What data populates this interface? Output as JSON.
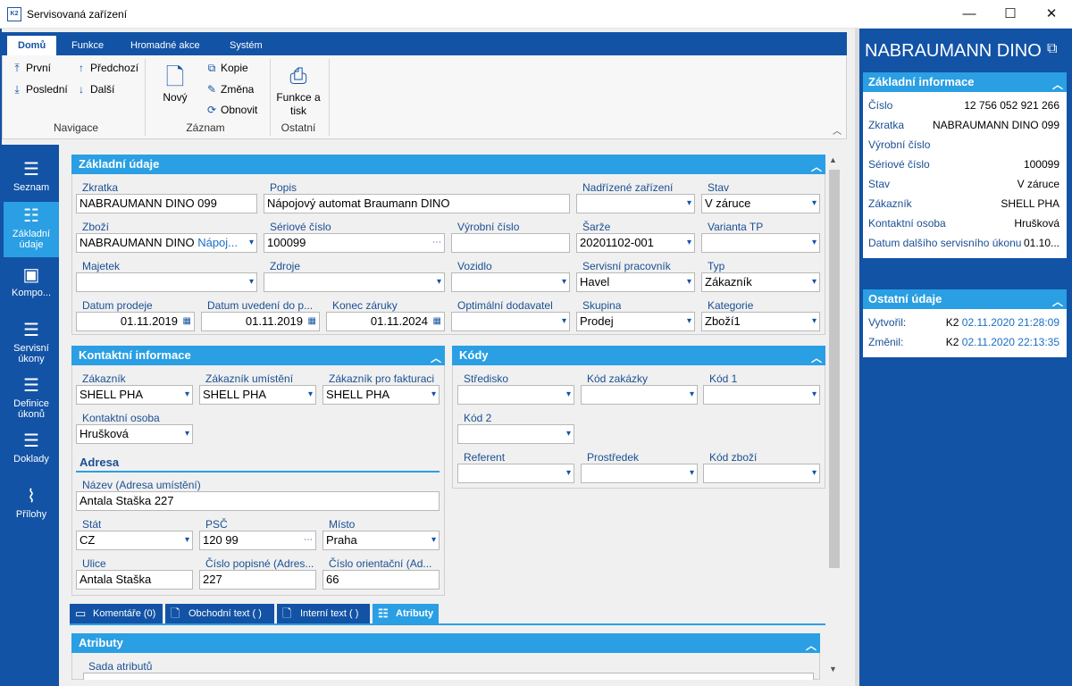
{
  "window": {
    "title": "Servisovaná zařízení",
    "minimize": "—",
    "maximize": "☐",
    "close": "✕"
  },
  "ribbon": {
    "tabs": [
      "Domů",
      "Funkce",
      "Hromadné akce",
      "Systém"
    ],
    "nav": {
      "first": "První",
      "prev": "Předchozí",
      "last": "Poslední",
      "next": "Další",
      "group": "Navigace"
    },
    "record": {
      "new": "Nový",
      "copy": "Kopie",
      "change": "Změna",
      "refresh": "Obnovit",
      "group": "Záznam"
    },
    "other": {
      "print": "Funkce a tisk",
      "group": "Ostatní"
    }
  },
  "leftnav": [
    "Seznam",
    "Základní údaje",
    "Kompo...",
    "Servisní úkony",
    "Definice úkonů",
    "Doklady",
    "Přílohy"
  ],
  "basic": {
    "title": "Základní údaje",
    "zkratka_l": "Zkratka",
    "zkratka": "NABRAUMANN DINO 099",
    "popis_l": "Popis",
    "popis": "Nápojový automat Braumann DINO",
    "nadrizene_l": "Nadřízené zařízení",
    "nadrizene": "",
    "stav_l": "Stav",
    "stav": "V záruce",
    "zbozi_l": "Zboží",
    "zbozi": "NABRAUMANN DINO",
    "zbozi2": "Nápoj...",
    "seriove_l": "Sériové číslo",
    "seriove": "100099",
    "vyrobni_l": "Výrobní číslo",
    "vyrobni": "",
    "sarze_l": "Šarže",
    "sarze": "20201102-001",
    "varianta_l": "Varianta TP",
    "varianta": "",
    "majetek_l": "Majetek",
    "majetek": "",
    "zdroje_l": "Zdroje",
    "zdroje": "",
    "vozidlo_l": "Vozidlo",
    "vozidlo": "",
    "pracovnik_l": "Servisní pracovník",
    "pracovnik": "Havel",
    "typ_l": "Typ",
    "typ": "Zákazník",
    "prodej_l": "Datum prodeje",
    "prodej": "01.11.2019",
    "uvedeni_l": "Datum uvedení do p...",
    "uvedeni": "01.11.2019",
    "zaruka_l": "Konec záruky",
    "zaruka": "01.11.2024",
    "dodavatel_l": "Optimální dodavatel",
    "dodavatel": "",
    "skupina_l": "Skupina",
    "skupina": "Prodej",
    "kategorie_l": "Kategorie",
    "kategorie": "Zboží1"
  },
  "contact": {
    "title": "Kontaktní informace",
    "zak_l": "Zákazník",
    "zak": "SHELL PHA",
    "zakum_l": "Zákazník umístění",
    "zakum": "SHELL PHA",
    "zakfak_l": "Zákazník pro fakturaci",
    "zakfak": "SHELL PHA",
    "osoba_l": "Kontaktní osoba",
    "osoba": "Hrušková",
    "adresa": "Adresa",
    "nazev_l": "Název (Adresa umístění)",
    "nazev": "Antala Staška 227",
    "stat_l": "Stát",
    "stat": "CZ",
    "psc_l": "PSČ",
    "psc": "120 99",
    "misto_l": "Místo",
    "misto": "Praha",
    "ulice_l": "Ulice",
    "ulice": "Antala Staška",
    "popisne_l": "Číslo popisné (Adres...",
    "popisne": "227",
    "orient_l": "Číslo orientační (Ad...",
    "orient": "66"
  },
  "codes": {
    "title": "Kódy",
    "stredisko_l": "Středisko",
    "zakazka_l": "Kód zakázky",
    "kod1_l": "Kód 1",
    "kod2_l": "Kód 2",
    "referent_l": "Referent",
    "prostredek_l": "Prostředek",
    "kodzbozi_l": "Kód zboží"
  },
  "btabs": [
    "Komentáře (0)",
    "Obchodní text ( )",
    "Interní text ( )",
    "Atributy"
  ],
  "attrs": {
    "title": "Atributy",
    "sada_l": "Sada atributů"
  },
  "right": {
    "title": "NABRAUMANN DINO",
    "basic_title": "Základní informace",
    "rows": [
      {
        "l": "Číslo",
        "v": "12 756 052 921 266"
      },
      {
        "l": "Zkratka",
        "v": "NABRAUMANN DINO 099"
      },
      {
        "l": "Výrobní číslo",
        "v": ""
      },
      {
        "l": "Sériové číslo",
        "v": "100099"
      },
      {
        "l": "Stav",
        "v": "V záruce"
      },
      {
        "l": "Zákazník",
        "v": "SHELL PHA"
      },
      {
        "l": "Kontaktní osoba",
        "v": "Hrušková"
      },
      {
        "l": "Datum dalšího servisního úkonu",
        "v": "01.10..."
      }
    ],
    "other_title": "Ostatní údaje",
    "created_l": "Vytvořil:",
    "created_u": "K2",
    "created_d": "02.11.2020 21:28:09",
    "changed_l": "Změnil:",
    "changed_u": "K2",
    "changed_d": "02.11.2020 22:13:35"
  }
}
